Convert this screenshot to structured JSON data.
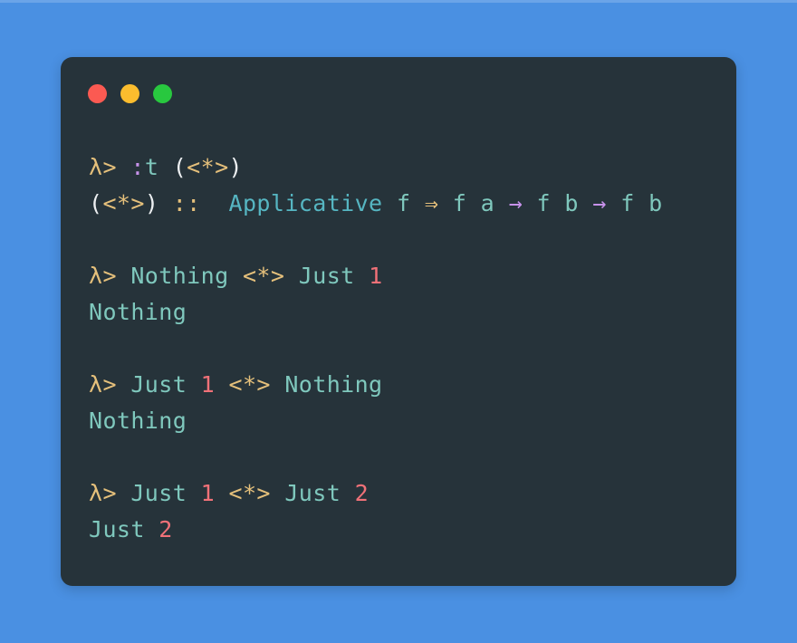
{
  "window": {
    "background_color": "#4a90e2",
    "terminal_background": "#26333a",
    "controls": [
      {
        "name": "close",
        "color": "#fb5a52"
      },
      {
        "name": "minimize",
        "color": "#fbbd2e"
      },
      {
        "name": "maximize",
        "color": "#28c83f"
      }
    ]
  },
  "palette": {
    "prompt": "#e5c07b",
    "operator": "#e5c07b",
    "identifier": "#7fc8bd",
    "typeclass": "#56b6c2",
    "number": "#f07178",
    "paren": "#eceff1",
    "colon": "#c792ea",
    "arrow": "#c792ea"
  },
  "session": {
    "prompt": "λ>",
    "operator": "<*>",
    "lines": [
      {
        "id": "cmd-1",
        "kind": "command",
        "text": "λ> :t (<*>)",
        "tokens": [
          {
            "t": "λ>",
            "c": "tok-prompt"
          },
          {
            "t": " ",
            "c": "tok-plain"
          },
          {
            "t": ":",
            "c": "tok-colon"
          },
          {
            "t": "t",
            "c": "tok-ident"
          },
          {
            "t": " ",
            "c": "tok-plain"
          },
          {
            "t": "(",
            "c": "tok-paren"
          },
          {
            "t": "<*>",
            "c": "tok-op"
          },
          {
            "t": ")",
            "c": "tok-paren"
          }
        ]
      },
      {
        "id": "out-1",
        "kind": "output",
        "text": "(<*>) :: Applicative f => f a -> f b -> f b",
        "tokens": [
          {
            "t": "(",
            "c": "tok-paren"
          },
          {
            "t": "<*>",
            "c": "tok-op"
          },
          {
            "t": ")",
            "c": "tok-paren"
          },
          {
            "t": " ",
            "c": "tok-plain"
          },
          {
            "t": "::",
            "c": "tok-dcolon"
          },
          {
            "t": "  ",
            "c": "tok-plain"
          },
          {
            "t": "Applicative",
            "c": "tok-class"
          },
          {
            "t": " ",
            "c": "tok-plain"
          },
          {
            "t": "f",
            "c": "tok-ident"
          },
          {
            "t": " ",
            "c": "tok-plain"
          },
          {
            "t": "⇒",
            "c": "tok-fatarrow"
          },
          {
            "t": " ",
            "c": "tok-plain"
          },
          {
            "t": "f",
            "c": "tok-ident"
          },
          {
            "t": " ",
            "c": "tok-plain"
          },
          {
            "t": "a",
            "c": "tok-ident"
          },
          {
            "t": " ",
            "c": "tok-plain"
          },
          {
            "t": "→",
            "c": "tok-arrow"
          },
          {
            "t": " ",
            "c": "tok-plain"
          },
          {
            "t": "f",
            "c": "tok-ident"
          },
          {
            "t": " ",
            "c": "tok-plain"
          },
          {
            "t": "b",
            "c": "tok-ident"
          },
          {
            "t": " ",
            "c": "tok-plain"
          },
          {
            "t": "→",
            "c": "tok-arrow"
          },
          {
            "t": " ",
            "c": "tok-plain"
          },
          {
            "t": "f",
            "c": "tok-ident"
          },
          {
            "t": " ",
            "c": "tok-plain"
          },
          {
            "t": "b",
            "c": "tok-ident"
          }
        ]
      },
      {
        "id": "blank-1",
        "kind": "blank",
        "text": "",
        "tokens": []
      },
      {
        "id": "cmd-2",
        "kind": "command",
        "text": "λ> Nothing <*> Just 1",
        "tokens": [
          {
            "t": "λ>",
            "c": "tok-prompt"
          },
          {
            "t": " ",
            "c": "tok-plain"
          },
          {
            "t": "Nothing",
            "c": "tok-ident"
          },
          {
            "t": " ",
            "c": "tok-plain"
          },
          {
            "t": "<*>",
            "c": "tok-op"
          },
          {
            "t": " ",
            "c": "tok-plain"
          },
          {
            "t": "Just",
            "c": "tok-ident"
          },
          {
            "t": " ",
            "c": "tok-plain"
          },
          {
            "t": "1",
            "c": "tok-num"
          }
        ]
      },
      {
        "id": "out-2",
        "kind": "output",
        "text": "Nothing",
        "tokens": [
          {
            "t": "Nothing",
            "c": "tok-ident"
          }
        ]
      },
      {
        "id": "blank-2",
        "kind": "blank",
        "text": "",
        "tokens": []
      },
      {
        "id": "cmd-3",
        "kind": "command",
        "text": "λ> Just 1 <*> Nothing",
        "tokens": [
          {
            "t": "λ>",
            "c": "tok-prompt"
          },
          {
            "t": " ",
            "c": "tok-plain"
          },
          {
            "t": "Just",
            "c": "tok-ident"
          },
          {
            "t": " ",
            "c": "tok-plain"
          },
          {
            "t": "1",
            "c": "tok-num"
          },
          {
            "t": " ",
            "c": "tok-plain"
          },
          {
            "t": "<*>",
            "c": "tok-op"
          },
          {
            "t": " ",
            "c": "tok-plain"
          },
          {
            "t": "Nothing",
            "c": "tok-ident"
          }
        ]
      },
      {
        "id": "out-3",
        "kind": "output",
        "text": "Nothing",
        "tokens": [
          {
            "t": "Nothing",
            "c": "tok-ident"
          }
        ]
      },
      {
        "id": "blank-3",
        "kind": "blank",
        "text": "",
        "tokens": []
      },
      {
        "id": "cmd-4",
        "kind": "command",
        "text": "λ> Just 1 <*> Just 2",
        "tokens": [
          {
            "t": "λ>",
            "c": "tok-prompt"
          },
          {
            "t": " ",
            "c": "tok-plain"
          },
          {
            "t": "Just",
            "c": "tok-ident"
          },
          {
            "t": " ",
            "c": "tok-plain"
          },
          {
            "t": "1",
            "c": "tok-num"
          },
          {
            "t": " ",
            "c": "tok-plain"
          },
          {
            "t": "<*>",
            "c": "tok-op"
          },
          {
            "t": " ",
            "c": "tok-plain"
          },
          {
            "t": "Just",
            "c": "tok-ident"
          },
          {
            "t": " ",
            "c": "tok-plain"
          },
          {
            "t": "2",
            "c": "tok-num"
          }
        ]
      },
      {
        "id": "out-4",
        "kind": "output",
        "text": "Just 2",
        "tokens": [
          {
            "t": "Just",
            "c": "tok-ident"
          },
          {
            "t": " ",
            "c": "tok-plain"
          },
          {
            "t": "2",
            "c": "tok-num"
          }
        ]
      }
    ]
  }
}
